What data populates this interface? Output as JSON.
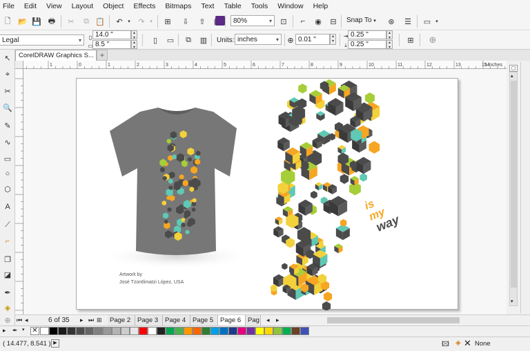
{
  "menu": [
    "File",
    "Edit",
    "View",
    "Layout",
    "Object",
    "Effects",
    "Bitmaps",
    "Text",
    "Table",
    "Tools",
    "Window",
    "Help"
  ],
  "toolbar": {
    "zoom_value": "80%",
    "snap_label": "Snap To"
  },
  "property_bar": {
    "page_size": "Legal",
    "width": "14.0 \"",
    "height": "8.5 \"",
    "units_label": "Units:",
    "units_value": "inches",
    "nudge": "0.01 \"",
    "dup_x": "0.25 \"",
    "dup_y": "0.25 \""
  },
  "document_tab": "CorelDRAW Graphics S...",
  "ruler": {
    "h_ticks": [
      "2",
      "1",
      "0",
      "1",
      "2",
      "3",
      "4",
      "5",
      "6",
      "7",
      "8",
      "9",
      "10",
      "11",
      "12",
      "13",
      "14"
    ],
    "h_unit": "15 inches",
    "v_ticks": [
      "1",
      "2",
      "3",
      "4",
      "5",
      "6",
      "7",
      "8"
    ],
    "v_unit": "inches"
  },
  "artwork": {
    "credit_line1": "Artwork by",
    "credit_line2": "José Tzontlimatzi López, USA",
    "slogan": [
      "is",
      "my",
      "way"
    ]
  },
  "page_nav": {
    "counter": "6 of 35",
    "tabs": [
      "Page 2",
      "Page 3",
      "Page 4",
      "Page 5",
      "Page 6",
      "Pag"
    ],
    "active_index": 4
  },
  "palette_colors": [
    "#ffffff",
    "#000000",
    "#1a1a1a",
    "#333333",
    "#4d4d4d",
    "#666666",
    "#808080",
    "#999999",
    "#b3b3b3",
    "#cccccc",
    "#e6e6e6",
    "#ff0000",
    "#ffffff",
    "#222222",
    "#00a651",
    "#4caf50",
    "#ff9900",
    "#ff6600",
    "#2e7d32",
    "#00a0e9",
    "#0070c0",
    "#1e3a8a",
    "#e5007e",
    "#7030a0",
    "#ffff00",
    "#ffd700",
    "#8cc63f",
    "#00b050",
    "#6b4226",
    "#3f51b5"
  ],
  "status": {
    "coords": "( 14.477, 8.541 )",
    "fill_label": "None"
  },
  "colors": {
    "hex_dark": "#4b4b4b",
    "hex_orange": "#f6a623",
    "hex_teal": "#5fc9b5",
    "hex_lime": "#a6ce39",
    "hex_yellow": "#f2d13b",
    "shirt": "#7a7a7a"
  }
}
